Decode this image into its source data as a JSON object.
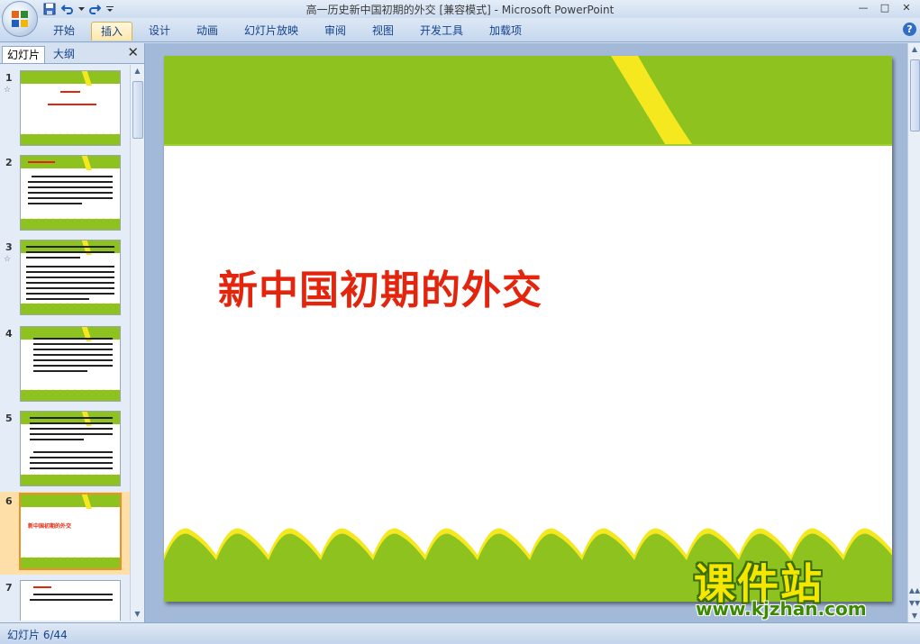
{
  "window": {
    "title": "高一历史新中国初期的外交 [兼容模式] - Microsoft PowerPoint",
    "minimize_glyph": "—",
    "maximize_glyph": "□",
    "close_glyph": "✕"
  },
  "quick_access": [
    "save-icon",
    "undo-icon",
    "redo-icon",
    "customize-icon"
  ],
  "ribbon_tabs": [
    "开始",
    "插入",
    "设计",
    "动画",
    "幻灯片放映",
    "审阅",
    "视图",
    "开发工具",
    "加载项"
  ],
  "active_tab": "插入",
  "help_glyph": "?",
  "left_pane": {
    "tabs": [
      "幻灯片",
      "大纲"
    ],
    "active_tab": "幻灯片",
    "close_glyph": "✕",
    "anim_glyph": "☆",
    "thumbnails": [
      {
        "num": "1",
        "has_anim": true
      },
      {
        "num": "2",
        "has_anim": false
      },
      {
        "num": "3",
        "has_anim": true
      },
      {
        "num": "4",
        "has_anim": false
      },
      {
        "num": "5",
        "has_anim": false
      },
      {
        "num": "6",
        "has_anim": false,
        "selected": true,
        "title": "新中国初期的外交"
      },
      {
        "num": "7",
        "has_anim": false
      }
    ]
  },
  "slide": {
    "title": "新中国初期的外交",
    "colors": {
      "green": "#8dc21f",
      "yellow": "#f5e81e",
      "title_red": "#e4250d"
    }
  },
  "status": {
    "slide_counter": "幻灯片 6/44"
  },
  "watermark": {
    "brand_cn": "课件站",
    "url": "www.kjzhan.com"
  }
}
